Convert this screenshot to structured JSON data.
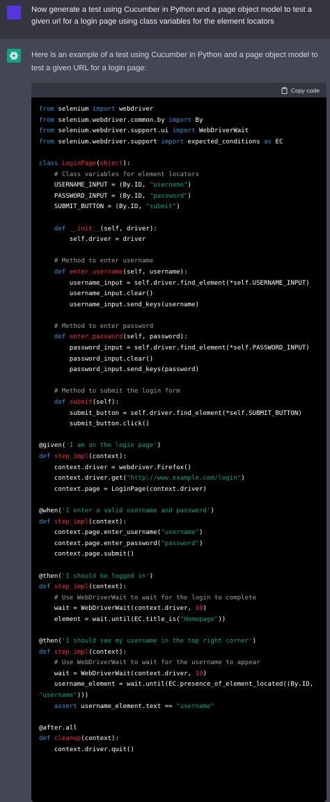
{
  "user_message": {
    "text": "Now generate a test using Cucumber in Python and a page object model to test a given url for a login page using class variables for the element locators"
  },
  "assistant_message": {
    "intro": "Here is an example of a test using Cucumber in Python and a page object model to test a given URL for a login page:",
    "code_block": {
      "copy_label": "Copy code",
      "lines": [
        [
          {
            "t": "from",
            "c": "kw"
          },
          {
            "t": " selenium "
          },
          {
            "t": "import",
            "c": "kw"
          },
          {
            "t": " webdriver"
          }
        ],
        [
          {
            "t": "from",
            "c": "kw"
          },
          {
            "t": " selenium.webdriver.common.by "
          },
          {
            "t": "import",
            "c": "kw"
          },
          {
            "t": " By"
          }
        ],
        [
          {
            "t": "from",
            "c": "kw"
          },
          {
            "t": " selenium.webdriver.support.ui "
          },
          {
            "t": "import",
            "c": "kw"
          },
          {
            "t": " WebDriverWait"
          }
        ],
        [
          {
            "t": "from",
            "c": "kw"
          },
          {
            "t": " selenium.webdriver.support "
          },
          {
            "t": "import",
            "c": "kw"
          },
          {
            "t": " expected_conditions "
          },
          {
            "t": "as",
            "c": "kw"
          },
          {
            "t": " EC"
          }
        ],
        [],
        [
          {
            "t": "class",
            "c": "kw"
          },
          {
            "t": " "
          },
          {
            "t": "LoginPage",
            "c": "cls"
          },
          {
            "t": "("
          },
          {
            "t": "object",
            "c": "cls"
          },
          {
            "t": "):"
          }
        ],
        [
          {
            "t": "    "
          },
          {
            "t": "# Class variables for element locators",
            "c": "cm"
          }
        ],
        [
          {
            "t": "    USERNAME_INPUT = (By.ID, "
          },
          {
            "t": "\"username\"",
            "c": "str"
          },
          {
            "t": ")"
          }
        ],
        [
          {
            "t": "    PASSWORD_INPUT = (By.ID, "
          },
          {
            "t": "\"password\"",
            "c": "str"
          },
          {
            "t": ")"
          }
        ],
        [
          {
            "t": "    SUBMIT_BUTTON = (By.ID, "
          },
          {
            "t": "\"submit\"",
            "c": "str"
          },
          {
            "t": ")"
          }
        ],
        [],
        [
          {
            "t": "    "
          },
          {
            "t": "def",
            "c": "kw"
          },
          {
            "t": " "
          },
          {
            "t": "__init__",
            "c": "fn"
          },
          {
            "t": "(self, driver):"
          }
        ],
        [
          {
            "t": "        self.driver = driver"
          }
        ],
        [],
        [
          {
            "t": "    "
          },
          {
            "t": "# Method to enter username",
            "c": "cm"
          }
        ],
        [
          {
            "t": "    "
          },
          {
            "t": "def",
            "c": "kw"
          },
          {
            "t": " "
          },
          {
            "t": "enter_username",
            "c": "fn"
          },
          {
            "t": "(self, username):"
          }
        ],
        [
          {
            "t": "        username_input = self.driver.find_element(*self.USERNAME_INPUT)"
          }
        ],
        [
          {
            "t": "        username_input.clear()"
          }
        ],
        [
          {
            "t": "        username_input.send_keys(username)"
          }
        ],
        [],
        [
          {
            "t": "    "
          },
          {
            "t": "# Method to enter password",
            "c": "cm"
          }
        ],
        [
          {
            "t": "    "
          },
          {
            "t": "def",
            "c": "kw"
          },
          {
            "t": " "
          },
          {
            "t": "enter_password",
            "c": "fn"
          },
          {
            "t": "(self, password):"
          }
        ],
        [
          {
            "t": "        password_input = self.driver.find_element(*self.PASSWORD_INPUT)"
          }
        ],
        [
          {
            "t": "        password_input.clear()"
          }
        ],
        [
          {
            "t": "        password_input.send_keys(password)"
          }
        ],
        [],
        [
          {
            "t": "    "
          },
          {
            "t": "# Method to submit the login form",
            "c": "cm"
          }
        ],
        [
          {
            "t": "    "
          },
          {
            "t": "def",
            "c": "kw"
          },
          {
            "t": " "
          },
          {
            "t": "submit",
            "c": "fn"
          },
          {
            "t": "(self):"
          }
        ],
        [
          {
            "t": "        submit_button = self.driver.find_element(*self.SUBMIT_BUTTON)"
          }
        ],
        [
          {
            "t": "        submit_button.click()"
          }
        ],
        [],
        [
          {
            "t": "@given",
            "c": "dec"
          },
          {
            "t": "("
          },
          {
            "t": "'I am on the login page'",
            "c": "str"
          },
          {
            "t": ")"
          }
        ],
        [
          {
            "t": "def",
            "c": "kw"
          },
          {
            "t": " "
          },
          {
            "t": "step_impl",
            "c": "fn"
          },
          {
            "t": "(context):"
          }
        ],
        [
          {
            "t": "    context.driver = webdriver.Firefox()"
          }
        ],
        [
          {
            "t": "    context.driver.get("
          },
          {
            "t": "\"http://www.example.com/login\"",
            "c": "str"
          },
          {
            "t": ")"
          }
        ],
        [
          {
            "t": "    context.page = LoginPage(context.driver)"
          }
        ],
        [],
        [
          {
            "t": "@when",
            "c": "dec"
          },
          {
            "t": "("
          },
          {
            "t": "'I enter a valid username and password'",
            "c": "str"
          },
          {
            "t": ")"
          }
        ],
        [
          {
            "t": "def",
            "c": "kw"
          },
          {
            "t": " "
          },
          {
            "t": "step_impl",
            "c": "fn"
          },
          {
            "t": "(context):"
          }
        ],
        [
          {
            "t": "    context.page.enter_username("
          },
          {
            "t": "\"username\"",
            "c": "str"
          },
          {
            "t": ")"
          }
        ],
        [
          {
            "t": "    context.page.enter_password("
          },
          {
            "t": "\"password\"",
            "c": "str"
          },
          {
            "t": ")"
          }
        ],
        [
          {
            "t": "    context.page.submit()"
          }
        ],
        [],
        [
          {
            "t": "@then",
            "c": "dec"
          },
          {
            "t": "("
          },
          {
            "t": "'I should be logged in'",
            "c": "str"
          },
          {
            "t": ")"
          }
        ],
        [
          {
            "t": "def",
            "c": "kw"
          },
          {
            "t": " "
          },
          {
            "t": "step_impl",
            "c": "fn"
          },
          {
            "t": "(context):"
          }
        ],
        [
          {
            "t": "    "
          },
          {
            "t": "# Use WebDriverWait to wait for the login to complete",
            "c": "cm"
          }
        ],
        [
          {
            "t": "    wait = WebDriverWait(context.driver, "
          },
          {
            "t": "10",
            "c": "num"
          },
          {
            "t": ")"
          }
        ],
        [
          {
            "t": "    element = wait.until(EC.title_is("
          },
          {
            "t": "\"Homepage\"",
            "c": "str"
          },
          {
            "t": "))"
          }
        ],
        [],
        [
          {
            "t": "@then",
            "c": "dec"
          },
          {
            "t": "("
          },
          {
            "t": "'I should see my username in the top right corner'",
            "c": "str"
          },
          {
            "t": ")"
          }
        ],
        [
          {
            "t": "def",
            "c": "kw"
          },
          {
            "t": " "
          },
          {
            "t": "step_impl",
            "c": "fn"
          },
          {
            "t": "(context):"
          }
        ],
        [
          {
            "t": "    "
          },
          {
            "t": "# Use WebDriverWait to wait for the username to appear",
            "c": "cm"
          }
        ],
        [
          {
            "t": "    wait = WebDriverWait(context.driver, "
          },
          {
            "t": "10",
            "c": "num"
          },
          {
            "t": ")"
          }
        ],
        [
          {
            "t": "    username_element = wait.until(EC.presence_of_element_located((By.ID,"
          }
        ],
        [
          {
            "t": "\"username\"",
            "c": "str"
          },
          {
            "t": ")))"
          }
        ],
        [
          {
            "t": "    "
          },
          {
            "t": "assert",
            "c": "kw"
          },
          {
            "t": " username_element.text == "
          },
          {
            "t": "\"username\"",
            "c": "str"
          }
        ],
        [],
        [
          {
            "t": "@after.all",
            "c": "dec"
          }
        ],
        [
          {
            "t": "def",
            "c": "kw"
          },
          {
            "t": " "
          },
          {
            "t": "cleanup",
            "c": "fn"
          },
          {
            "t": "(context):"
          }
        ],
        [
          {
            "t": "    context.driver.quit()"
          }
        ]
      ]
    }
  },
  "colors": {
    "user_bg": "#343541",
    "assistant_bg": "#444654",
    "user_avatar": "#5436DA",
    "bot_avatar": "#10a37f",
    "code_bg": "#000000",
    "keyword": "#2e95d3",
    "function": "#f22c3d",
    "string": "#00a67d",
    "comment": "#a0a0a0",
    "number": "#df3079"
  },
  "icons": {
    "user_avatar": "user-avatar-icon",
    "bot_avatar": "openai-logo-icon",
    "copy": "clipboard-icon"
  }
}
